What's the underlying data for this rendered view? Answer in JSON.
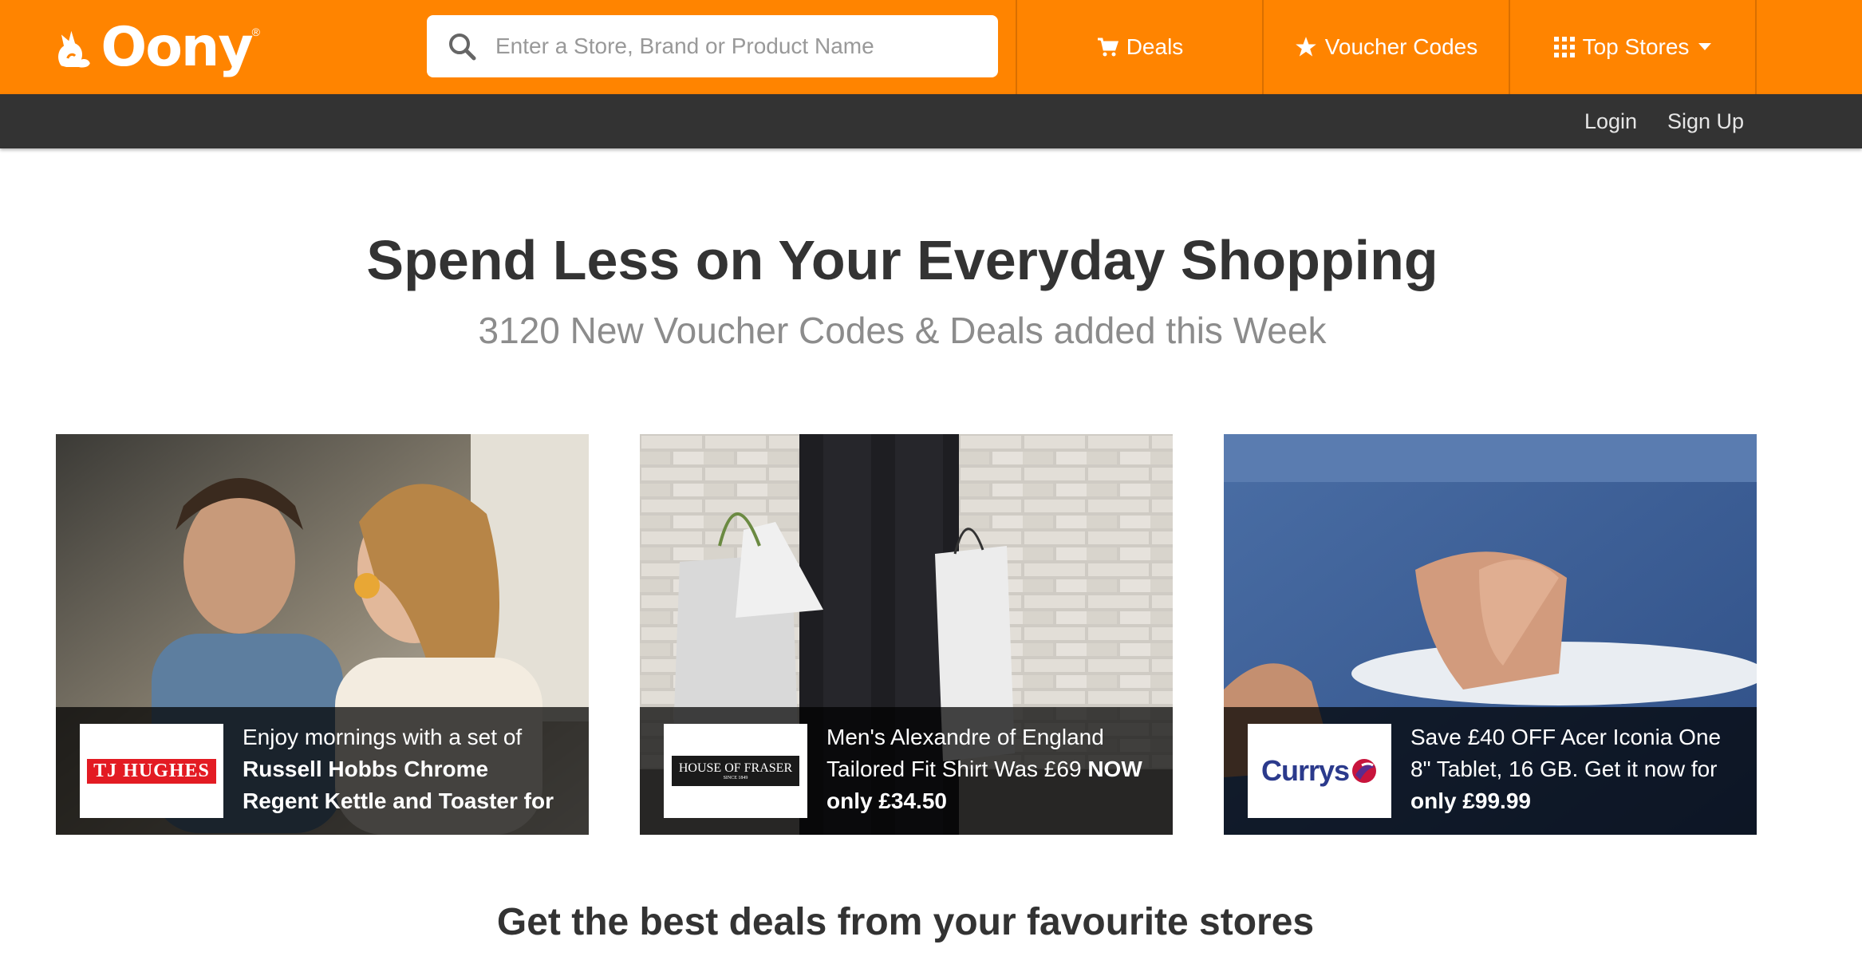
{
  "header": {
    "logo_text": "Oony",
    "logo_mark": "®",
    "search_placeholder": "Enter a Store, Brand or Product Name",
    "nav": {
      "deals": "Deals",
      "vouchers": "Voucher Codes",
      "stores": "Top Stores"
    },
    "brand_color": "#ff8400"
  },
  "subbar": {
    "login": "Login",
    "signup": "Sign Up"
  },
  "hero": {
    "title": "Spend Less on Your Everyday Shopping",
    "subtitle": "3120 New Voucher Codes & Deals added this Week"
  },
  "cards": [
    {
      "store": "TJ HUGHES",
      "text_plain": "Enjoy mornings with a set of ",
      "text_bold": "Russell Hobbs Chrome Regent Kettle and Toaster for",
      "text_after": ""
    },
    {
      "store": "HOUSE OF FRASER",
      "store_small": "SINCE 1849",
      "text_plain": "Men's Alexandre of England Tailored Fit Shirt Was £69 ",
      "text_bold": "NOW only £34.50",
      "text_after": ""
    },
    {
      "store": "Currys",
      "text_plain": "Save £40 OFF Acer Iconia One 8\" Tablet, 16 GB. Get it now for ",
      "text_bold": "only £99.99",
      "text_after": ""
    }
  ],
  "stores_heading": "Get the best deals from your favourite stores"
}
